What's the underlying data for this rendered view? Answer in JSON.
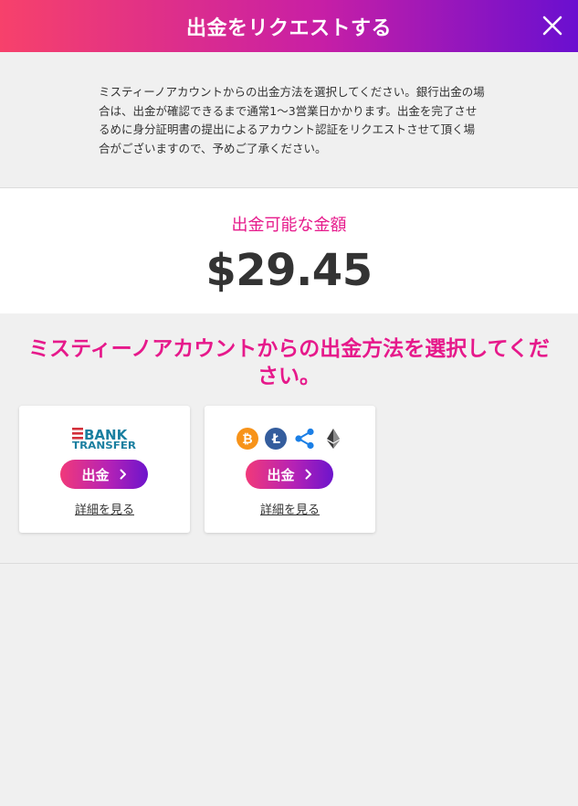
{
  "header": {
    "title": "出金をリクエストする",
    "close_icon": "close-icon"
  },
  "intro": {
    "text": "ミスティーノアカウントからの出金方法を選択してください。銀行出金の場合は、出金が確認できるまで通常1～3営業日かかります。出金を完了させるめに身分証明書の提出によるアカウント認証をリクエストさせて頂く場合がございますので、予めご了承ください。"
  },
  "balance": {
    "label": "出金可能な金額",
    "amount": "$29.45"
  },
  "methods": {
    "heading": "ミスティーノアカウントからの出金方法を選択してください。",
    "cards": [
      {
        "id": "bank",
        "logo_line1": "BANK",
        "logo_line2": "TRANSFER",
        "button_label": "出金",
        "details_label": "詳細を見る"
      },
      {
        "id": "crypto",
        "icons": [
          "bitcoin-icon",
          "litecoin-icon",
          "ripple-icon",
          "ethereum-icon"
        ],
        "button_label": "出金",
        "details_label": "詳細を見る"
      }
    ]
  },
  "colors": {
    "accent_pink": "#e6198b",
    "gradient_start": "#f7416b",
    "gradient_end": "#6a0fd0",
    "bank_red": "#d32f3a",
    "bank_teal": "#1a7fa0",
    "bitcoin": "#f7931a",
    "litecoin": "#345d9d",
    "ripple": "#1b7fe6",
    "ethereum": "#3c3c3d"
  }
}
